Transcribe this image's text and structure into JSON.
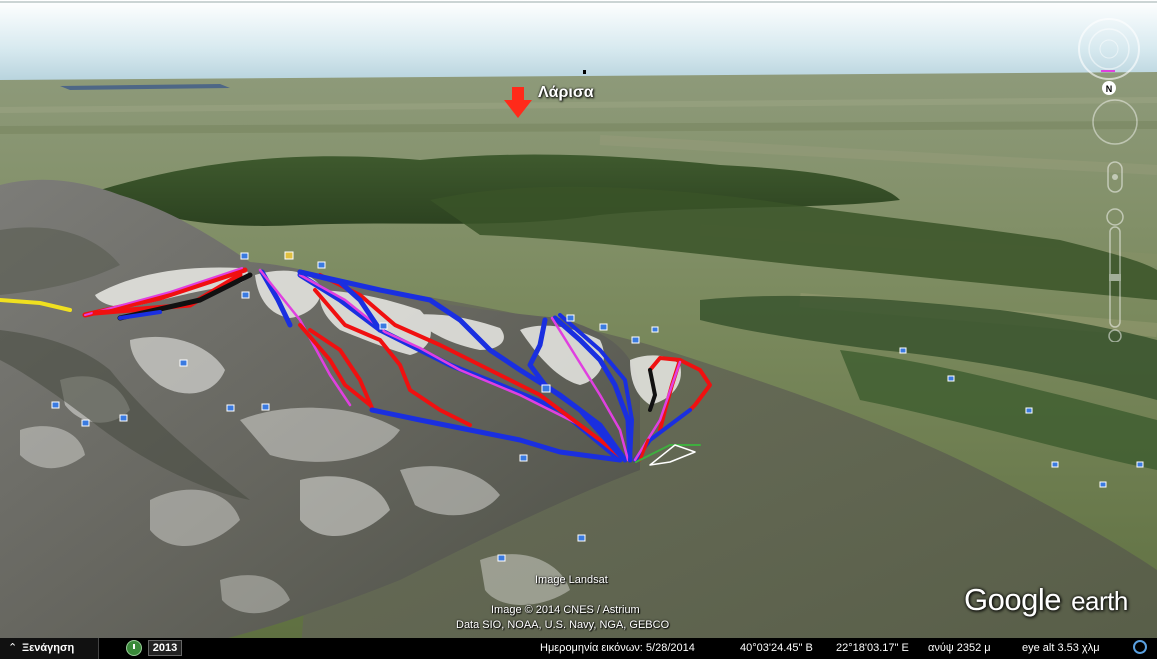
{
  "map": {
    "place_label": "Λάρισα",
    "imagery_credit": "Image Landsat",
    "copyright_line1": "Image © 2014 CNES / Astrium",
    "copyright_line2": "Data SIO, NOAA, U.S. Navy, NGA, GEBCO",
    "logo_google": "Google",
    "logo_earth": "earth",
    "compass_letter": "N",
    "colors": {
      "sky": "#cde3ec",
      "blue_run": "#1a2fe0",
      "red_run": "#f01010",
      "black_run": "#111111",
      "pink_lift": "#e040e0",
      "yellow_trail": "#f0e020",
      "marker": "#ff2a1a"
    }
  },
  "statusbar": {
    "tour_label": "Ξενάγηση",
    "year": "2013",
    "image_date": "Ημερομηνία εικόνων: 5/28/2014",
    "latitude": "40°03'24.45\" Β",
    "longitude": "22°18'03.17\" Ε",
    "elevation": "ανύψ  2352 μ",
    "eye_alt": "eye alt   3.53 χλμ"
  },
  "icons": {
    "compass": "compass-icon",
    "look": "look-joystick-icon",
    "move": "move-joystick-icon",
    "zoom": "zoom-slider-icon",
    "clock": "clock-icon",
    "tour_chevron": "chevron-up-icon",
    "stream": "streaming-icon",
    "placemark": "photo-placemark-icon",
    "arrow": "down-arrow-icon"
  }
}
